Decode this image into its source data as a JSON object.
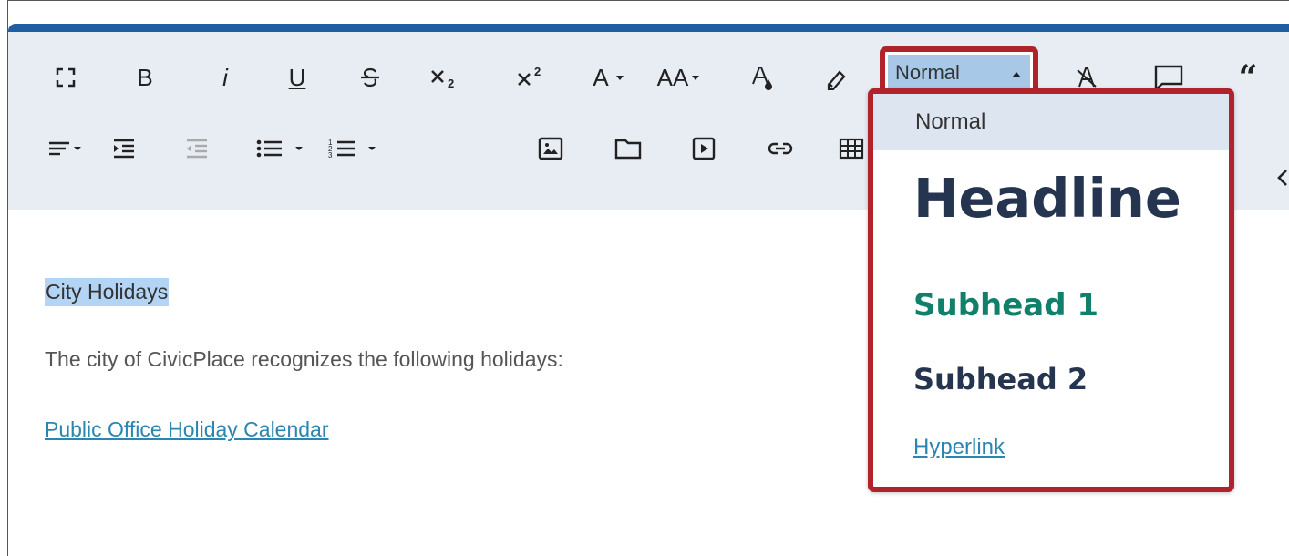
{
  "toolbar": {
    "row1": [
      {
        "name": "fullscreen-icon",
        "label": ""
      },
      {
        "name": "bold-button",
        "label": "B"
      },
      {
        "name": "italic-button",
        "label": "i"
      },
      {
        "name": "underline-button",
        "label": "U"
      },
      {
        "name": "strikethrough-button",
        "label": ""
      },
      {
        "name": "subscript-button",
        "label": ""
      },
      {
        "name": "superscript-button",
        "label": ""
      },
      {
        "name": "font-color-button",
        "label": "A"
      },
      {
        "name": "font-size-button",
        "label": "AA"
      },
      {
        "name": "background-color-button",
        "label": "A"
      },
      {
        "name": "clear-format-button",
        "label": ""
      }
    ],
    "format_select": {
      "value": "Normal"
    }
  },
  "dropdown": {
    "items": [
      {
        "label": "Normal",
        "selected": true
      },
      {
        "label": "Headline"
      },
      {
        "label": "Subhead 1"
      },
      {
        "label": "Subhead 2"
      },
      {
        "label": "Hyperlink"
      }
    ]
  },
  "content": {
    "selected_heading": "City Holidays",
    "paragraph": "The city of CivicPlace recognizes the following holidays:",
    "link": "Public Office Holiday Calendar"
  },
  "colors": {
    "accent": "#1f5ea1",
    "highlight_border": "#b0232b",
    "select_bg": "#a8c8e8",
    "subhead1": "#11806a",
    "headline": "#253550",
    "link": "#2a86b0"
  }
}
